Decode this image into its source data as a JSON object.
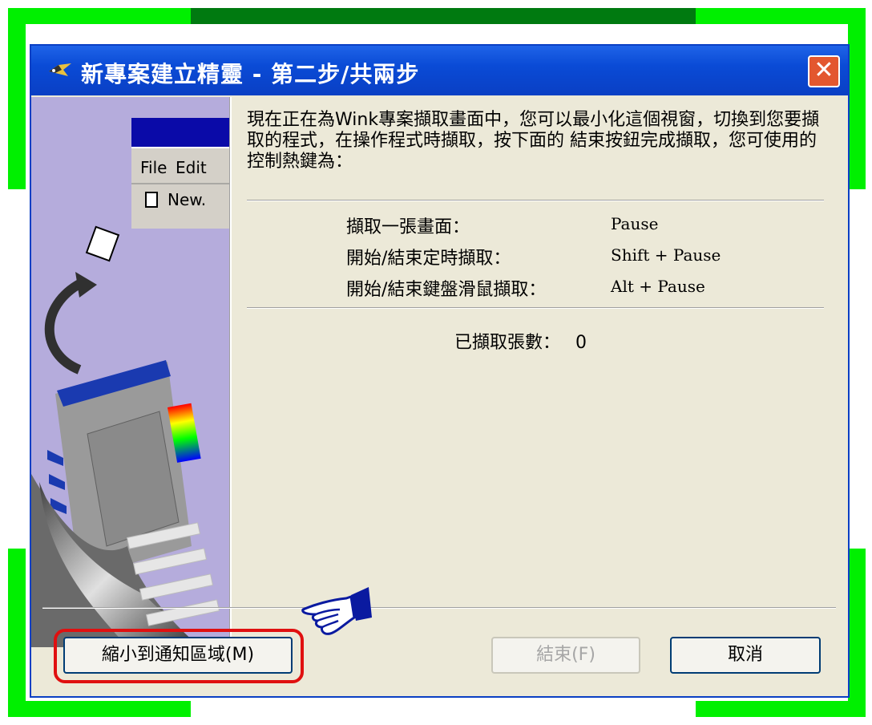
{
  "window": {
    "title": "新專案建立精靈 - 第二步/共兩步"
  },
  "instructions": "現在正在為Wink專案擷取畫面中，您可以最小化這個視窗，切換到您要擷取的程式，在操作程式時擷取，按下面的 結束按鈕完成擷取，您可使用的控制熱鍵為：",
  "hotkeys": [
    {
      "label": "擷取一張畫面：",
      "key": "Pause"
    },
    {
      "label": "開始/結束定時擷取：",
      "key": "Shift + Pause"
    },
    {
      "label": "開始/結束鍵盤滑鼠擷取：",
      "key": "Alt + Pause"
    }
  ],
  "capture_count": {
    "label": "已擷取張數：",
    "value": "0"
  },
  "preview": {
    "menu_file": "File",
    "menu_edit": "Edit",
    "menu_new": "New."
  },
  "buttons": {
    "minimize": "縮小到通知區域(M)",
    "finish": "結束(F)",
    "cancel": "取消"
  },
  "colors": {
    "frame_green": "#00f000",
    "frame_dark_green": "#007a10",
    "titlebar_blue": "#0a4bd6",
    "highlight_red": "#e01010"
  }
}
